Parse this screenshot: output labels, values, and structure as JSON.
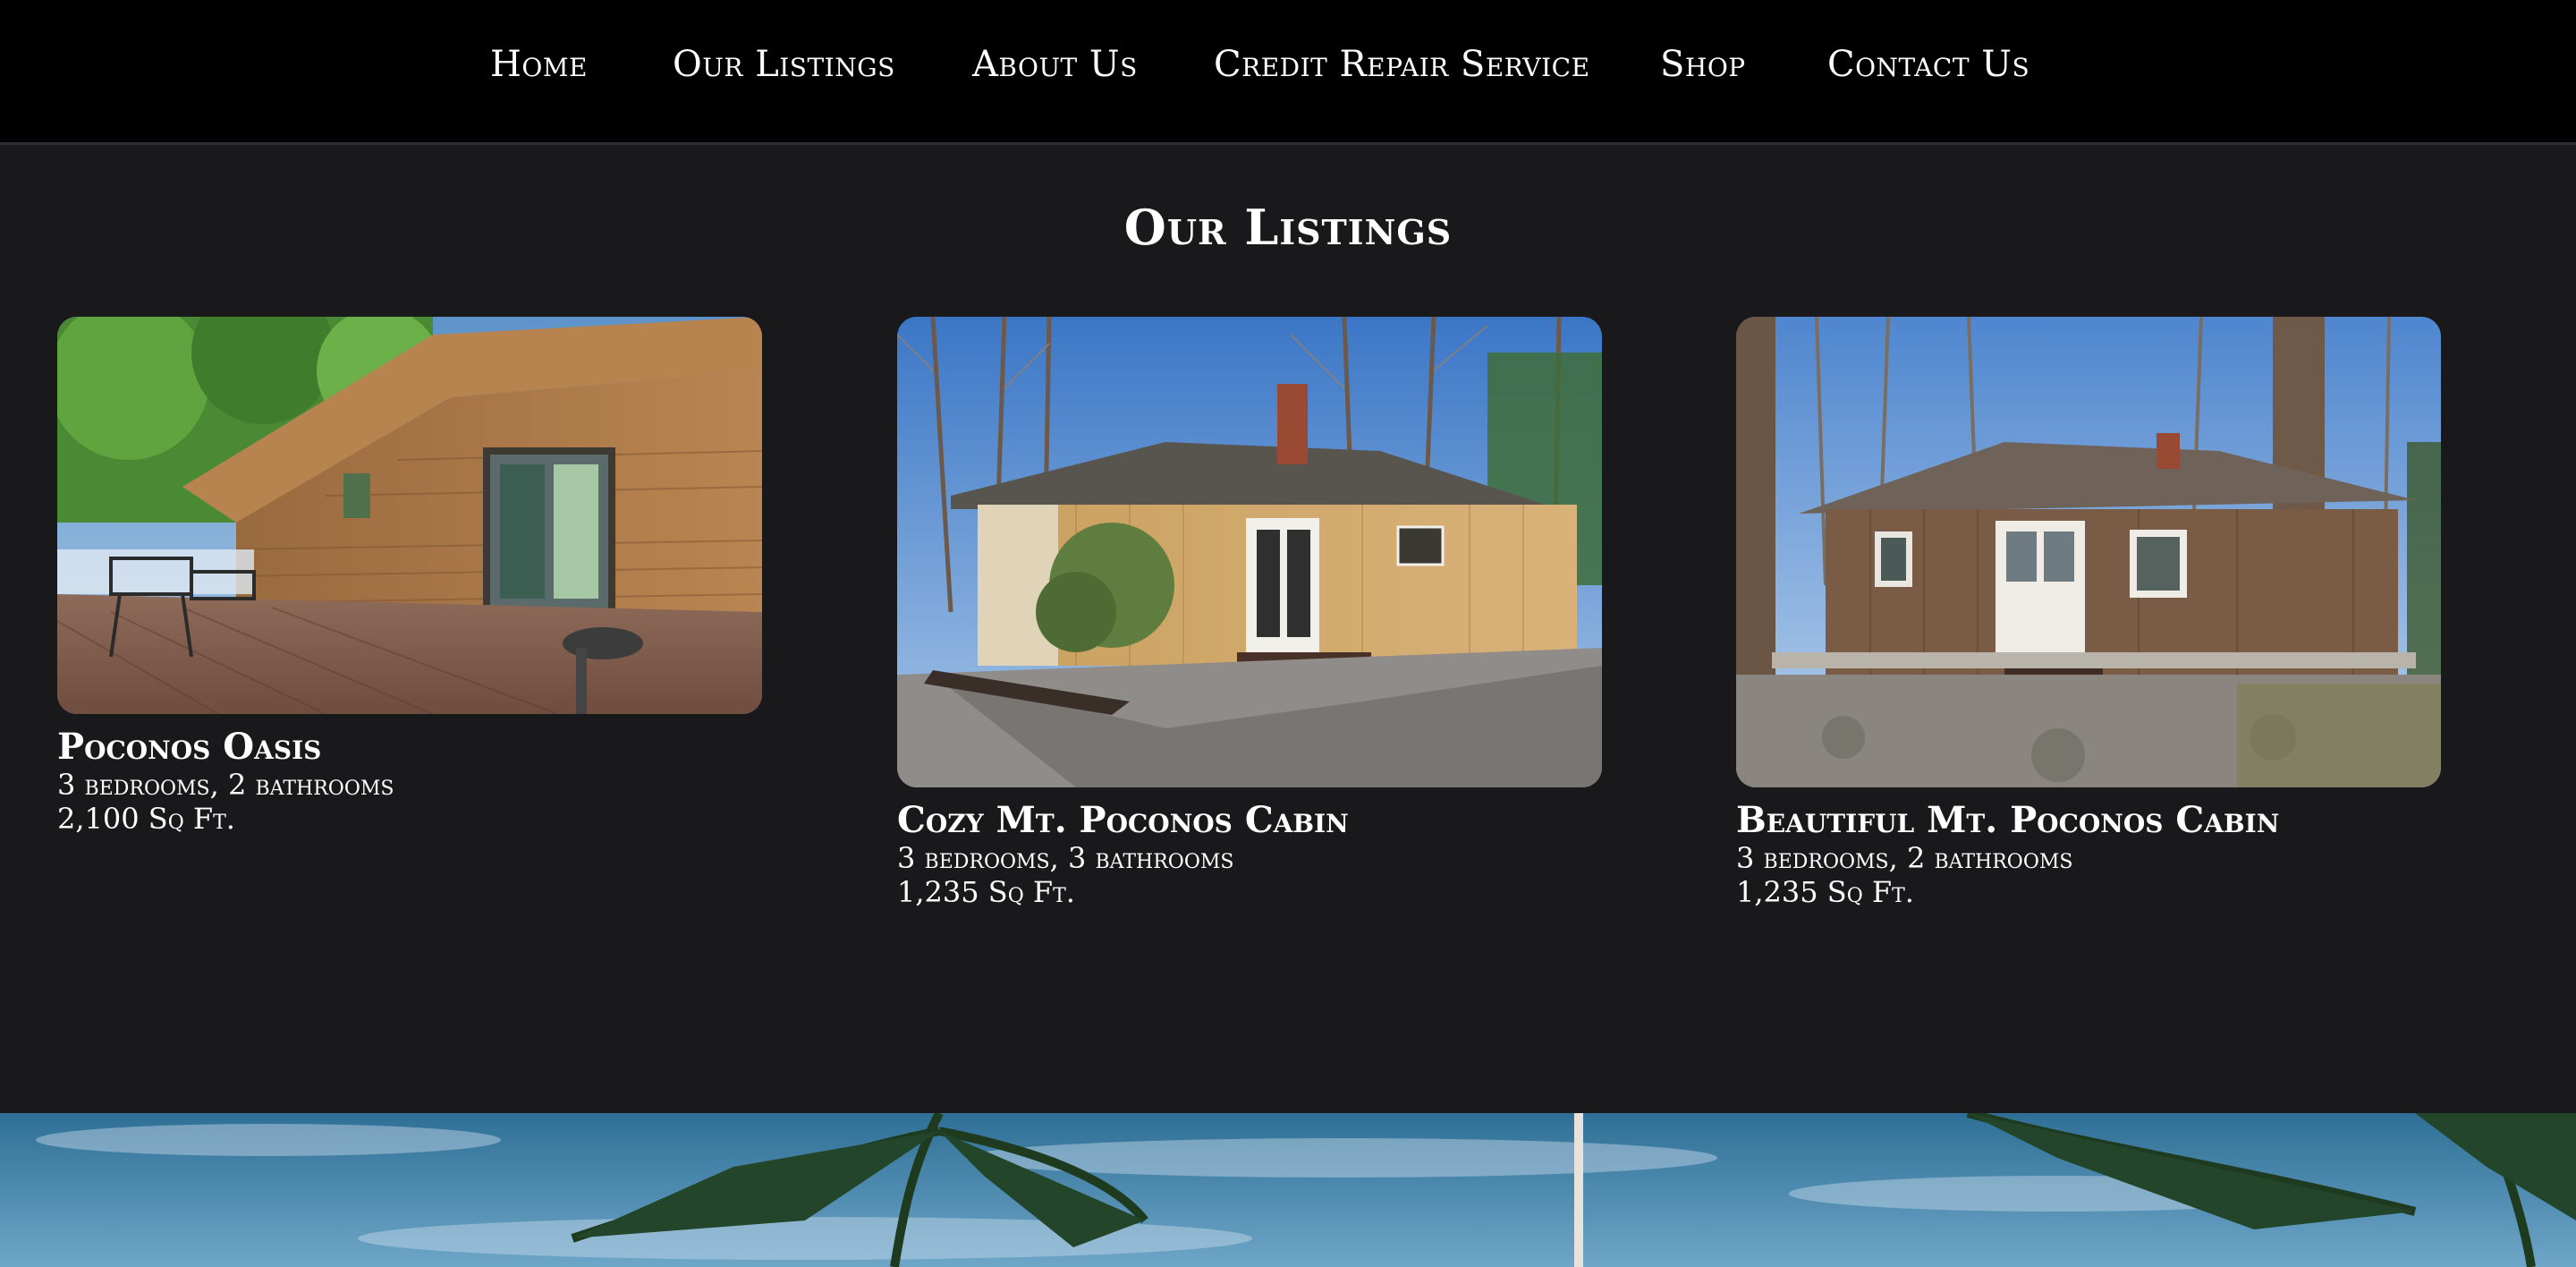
{
  "nav": {
    "items": [
      {
        "label": "Home"
      },
      {
        "label": "Our Listings"
      },
      {
        "label": "About Us"
      },
      {
        "label": "Credit Repair Service"
      },
      {
        "label": "Shop"
      },
      {
        "label": "Contact Us"
      }
    ]
  },
  "main": {
    "title": "Our Listings",
    "listings": [
      {
        "title": "Poconos Oasis",
        "rooms": "3 bedrooms, 2 bathrooms",
        "area": "2,100 Sq Ft."
      },
      {
        "title": "Cozy Mt. Poconos Cabin",
        "rooms": "3 bedrooms, 3 bathrooms",
        "area": "1,235 Sq Ft."
      },
      {
        "title": "Beautiful Mt. Poconos Cabin",
        "rooms": "3 bedrooms, 2 bathrooms",
        "area": "1,235 Sq Ft."
      }
    ]
  },
  "colors": {
    "nav_background": "#000000",
    "page_background": "#19181a",
    "text": "#ffffff"
  }
}
